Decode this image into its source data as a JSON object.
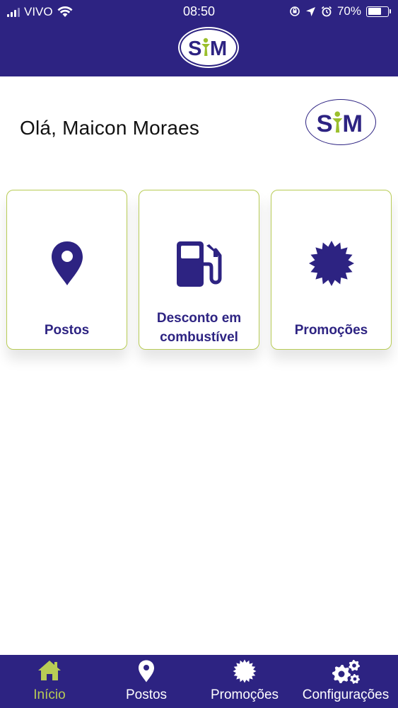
{
  "statusbar": {
    "carrier": "VIVO",
    "time": "08:50",
    "battery": "70%",
    "battery_level": 0.7
  },
  "logo": {
    "text_s": "S",
    "text_m": "M"
  },
  "greeting": "Olá, Maicon Moraes",
  "cards": [
    {
      "label": "Postos",
      "icon": "map-pin-icon"
    },
    {
      "label_line1": "Desconto em",
      "label_line2": "combustível",
      "icon": "fuel-pump-icon"
    },
    {
      "label": "Promoções",
      "icon": "starburst-badge-icon"
    }
  ],
  "tabs": [
    {
      "label": "Início",
      "icon": "home-icon",
      "active": true
    },
    {
      "label": "Postos",
      "icon": "map-pin-icon",
      "active": false
    },
    {
      "label": "Promoções",
      "icon": "starburst-badge-icon",
      "active": false
    },
    {
      "label": "Configurações",
      "icon": "gears-icon",
      "active": false
    }
  ],
  "colors": {
    "brand": "#2d2382",
    "accent": "#b8cc55",
    "background": "#ffffff"
  }
}
